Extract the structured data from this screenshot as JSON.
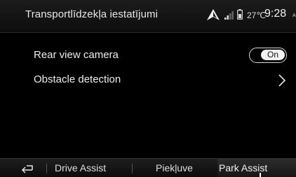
{
  "header": {
    "title": "Transportlīdzekļa iestatījumi",
    "temperature": "27℃",
    "time": "9:28",
    "ampm": "AM",
    "icons": [
      "navigation-arrow-icon",
      "signal-bars-icon",
      "battery-icon"
    ]
  },
  "settings": {
    "items": [
      {
        "label": "Rear view camera",
        "control": "toggle",
        "value": "On"
      },
      {
        "label": "Obstacle detection",
        "control": "chevron"
      }
    ]
  },
  "tabbar": {
    "back_icon": "back-arrow-icon",
    "tabs": [
      {
        "label": "Drive Assist"
      },
      {
        "label": "Piekļuve"
      },
      {
        "label": "Park Assist",
        "active": true
      }
    ]
  },
  "colors": {
    "background": "#000000",
    "text": "#ececec",
    "toggle_on": "#f2f2f2"
  }
}
